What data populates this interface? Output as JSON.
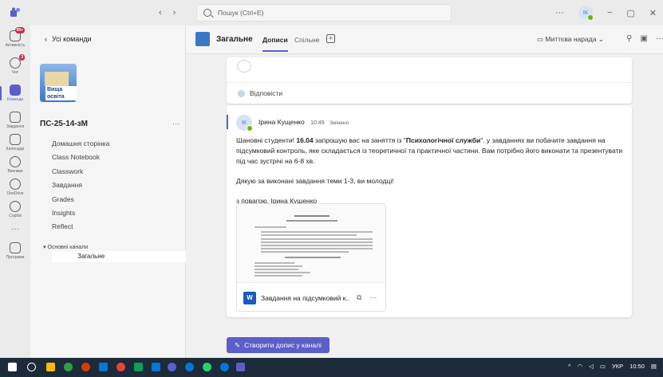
{
  "titlebar": {
    "search_placeholder": "Пошук (Ctrl+E)",
    "nav_back": "‹",
    "nav_forward": "›",
    "more": "···",
    "avatar_initials": "ІК",
    "minimize": "−",
    "restore": "▢",
    "close": "✕"
  },
  "rail": {
    "items": [
      {
        "label": "Активність",
        "badge": "99+"
      },
      {
        "label": "Чат",
        "badge": "3"
      },
      {
        "label": "Команди"
      },
      {
        "label": "Завдання"
      },
      {
        "label": "Календар"
      },
      {
        "label": "Виклики"
      },
      {
        "label": "OneDrive"
      },
      {
        "label": "Copilot"
      },
      {
        "label": "···"
      },
      {
        "label": "Програми"
      }
    ]
  },
  "team": {
    "back_label": "Усі команди",
    "logo_text": "Вища освіта",
    "name": "ПС-25-14-зМ",
    "more": "···",
    "nav": [
      "Домашня сторінка",
      "Class Notebook",
      "Classwork",
      "Завдання",
      "Grades",
      "Insights",
      "Reflect"
    ],
    "channels_header": "Основні канали",
    "channel_selected": "Загальне"
  },
  "channel": {
    "title": "Загальне",
    "tabs": [
      "Дописи",
      "Спільне"
    ],
    "meet_label": "Миттєва нарада"
  },
  "feed": {
    "reply_label": "Відповісти",
    "post": {
      "author_initials": "ІК",
      "author": "Ірина Кущенко",
      "time": "10:49",
      "edited": "Змінено",
      "p1_a": "Шановні студенти! ",
      "p1_date": "16.04",
      "p1_b": " запрошую вас на заняття із \"",
      "p1_bold": "Психологічної служби",
      "p1_c": "\". у завданнях ви побачите завдання на підсумковий контроль, яке складається із теоретичної та практичної частини. Вам потрібно його виконати та презентувати під час зустрічі на 6-8 хв.",
      "p2": "Дякую за виконані завдання теми 1-3, ви молодці!",
      "p3": "з повагою, Ірина Кущенко",
      "attachment_icon": "W",
      "attachment_name": "Завдання на підсумковий к..."
    }
  },
  "new_post_label": "Створити допис у каналі",
  "taskbar": {
    "lang": "УКР",
    "time": "10:50"
  },
  "colors": {
    "accent": "#5b5fc7",
    "word": "#185abd"
  }
}
